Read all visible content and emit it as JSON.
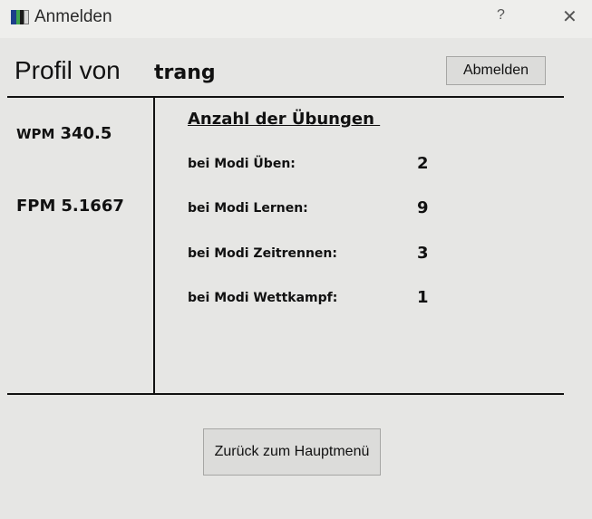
{
  "window": {
    "title": "Anmelden",
    "help_label": "?",
    "close_label": "✕",
    "icon_name": "app-icon"
  },
  "header": {
    "profile_label": "Profil von",
    "username": "trang",
    "logout_label": "Abmelden"
  },
  "stats": {
    "wpm_label": "WPM",
    "wpm_value": "340.5",
    "fpm_label": "FPM",
    "fpm_value": "5.1667"
  },
  "exercises": {
    "title": "Anzahl der Übungen ",
    "modes": [
      {
        "label": "bei Modi Üben:",
        "count": "2"
      },
      {
        "label": "bei Modi Lernen:",
        "count": "9"
      },
      {
        "label": "bei Modi Zeitrennen:",
        "count": "3"
      },
      {
        "label": "bei Modi Wettkampf:",
        "count": "1"
      }
    ]
  },
  "footer": {
    "main_menu_label": "Zurück zum Hauptmenü"
  },
  "colors": {
    "window_bg": "#e6e6e4",
    "titlebar_bg": "#eeeeec",
    "button_bg": "#dcdcda",
    "button_border": "#a6a6a4",
    "line": "#111111"
  }
}
